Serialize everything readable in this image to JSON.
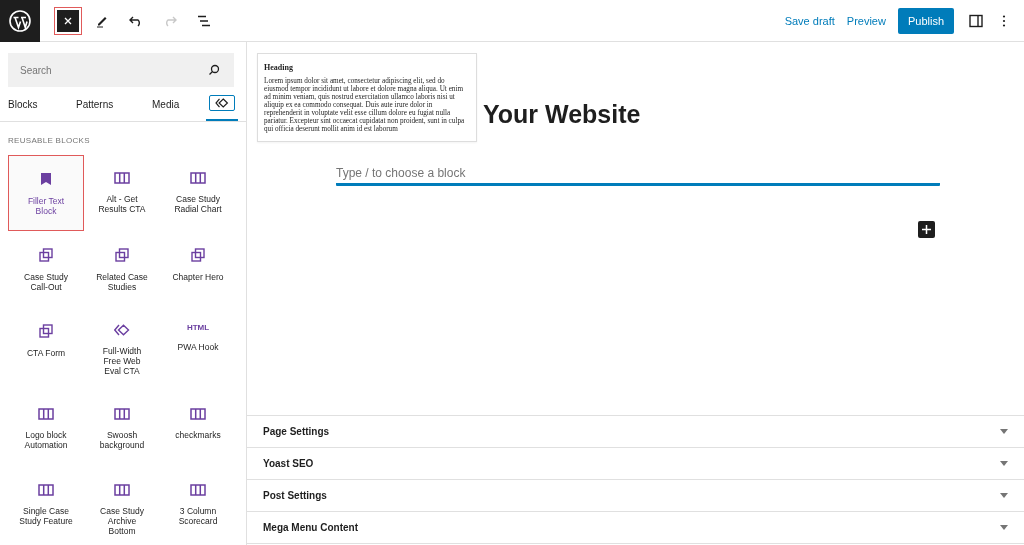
{
  "toolbar": {
    "close_selected": true,
    "redo_disabled": true,
    "save_draft": "Save draft",
    "preview": "Preview",
    "publish": "Publish",
    "settings_on": false
  },
  "inserter": {
    "search": {
      "placeholder": "Search"
    },
    "tabs": [
      {
        "kind": "text",
        "label": "Blocks",
        "selected": false
      },
      {
        "kind": "text",
        "label": "Patterns",
        "selected": false
      },
      {
        "kind": "text",
        "label": "Media",
        "selected": false
      },
      {
        "kind": "icon",
        "selected": true
      }
    ],
    "section_title": "REUSABLE BLOCKS",
    "blocks": [
      {
        "kind": "bookmark",
        "label": "Filler Text Block",
        "selected": true
      },
      {
        "kind": "columns",
        "label": "Alt - Get Results CTA",
        "selected": false
      },
      {
        "kind": "columns",
        "label": "Case Study Radial Chart",
        "selected": false
      },
      {
        "kind": "copy",
        "label": "Case Study Call-Out",
        "selected": false
      },
      {
        "kind": "copy",
        "label": "Related Case Studies",
        "selected": false
      },
      {
        "kind": "copy",
        "label": "Chapter Hero",
        "selected": false
      },
      {
        "kind": "copy",
        "label": "CTA Form",
        "selected": false
      },
      {
        "kind": "diamond",
        "label": "Full-Width Free Web Eval CTA",
        "selected": false
      },
      {
        "kind": "html",
        "icon_text": "HTML",
        "label": "PWA Hook",
        "selected": false
      },
      {
        "kind": "columns",
        "label": "Logo block Automation",
        "selected": false
      },
      {
        "kind": "columns",
        "label": "Swoosh background",
        "selected": false
      },
      {
        "kind": "columns",
        "label": "checkmarks",
        "selected": false
      },
      {
        "kind": "columns",
        "label": "Single Case Study Feature",
        "selected": false
      },
      {
        "kind": "columns",
        "label": "Case Study Archive Bottom",
        "selected": false
      },
      {
        "kind": "columns",
        "label": "3 Column Scorecard",
        "selected": false
      }
    ]
  },
  "editor": {
    "heading": "Your Website",
    "paragraph": {
      "placeholder": "Type / to choose a block"
    },
    "preview": {
      "heading": "Heading",
      "text": "Lorem ipsum dolor sit amet, consectetur adipiscing elit, sed do eiusmod tempor incididunt ut labore et dolore magna aliqua. Ut enim ad minim veniam, quis nostrud exercitation ullamco laboris nisi ut aliquip ex ea commodo consequat. Duis aute irure dolor in reprehenderit in voluptate velit esse cillum dolore eu fugiat nulla pariatur. Excepteur sint occaecat cupidatat non proident, sunt in culpa qui officia deserunt mollit anim id est laborum"
    }
  },
  "metaboxes": [
    {
      "title": "Page Settings",
      "expanded": false
    },
    {
      "title": "Yoast SEO",
      "expanded": false
    },
    {
      "title": "Post Settings",
      "expanded": false
    },
    {
      "title": "Mega Menu Content",
      "expanded": false
    }
  ]
}
